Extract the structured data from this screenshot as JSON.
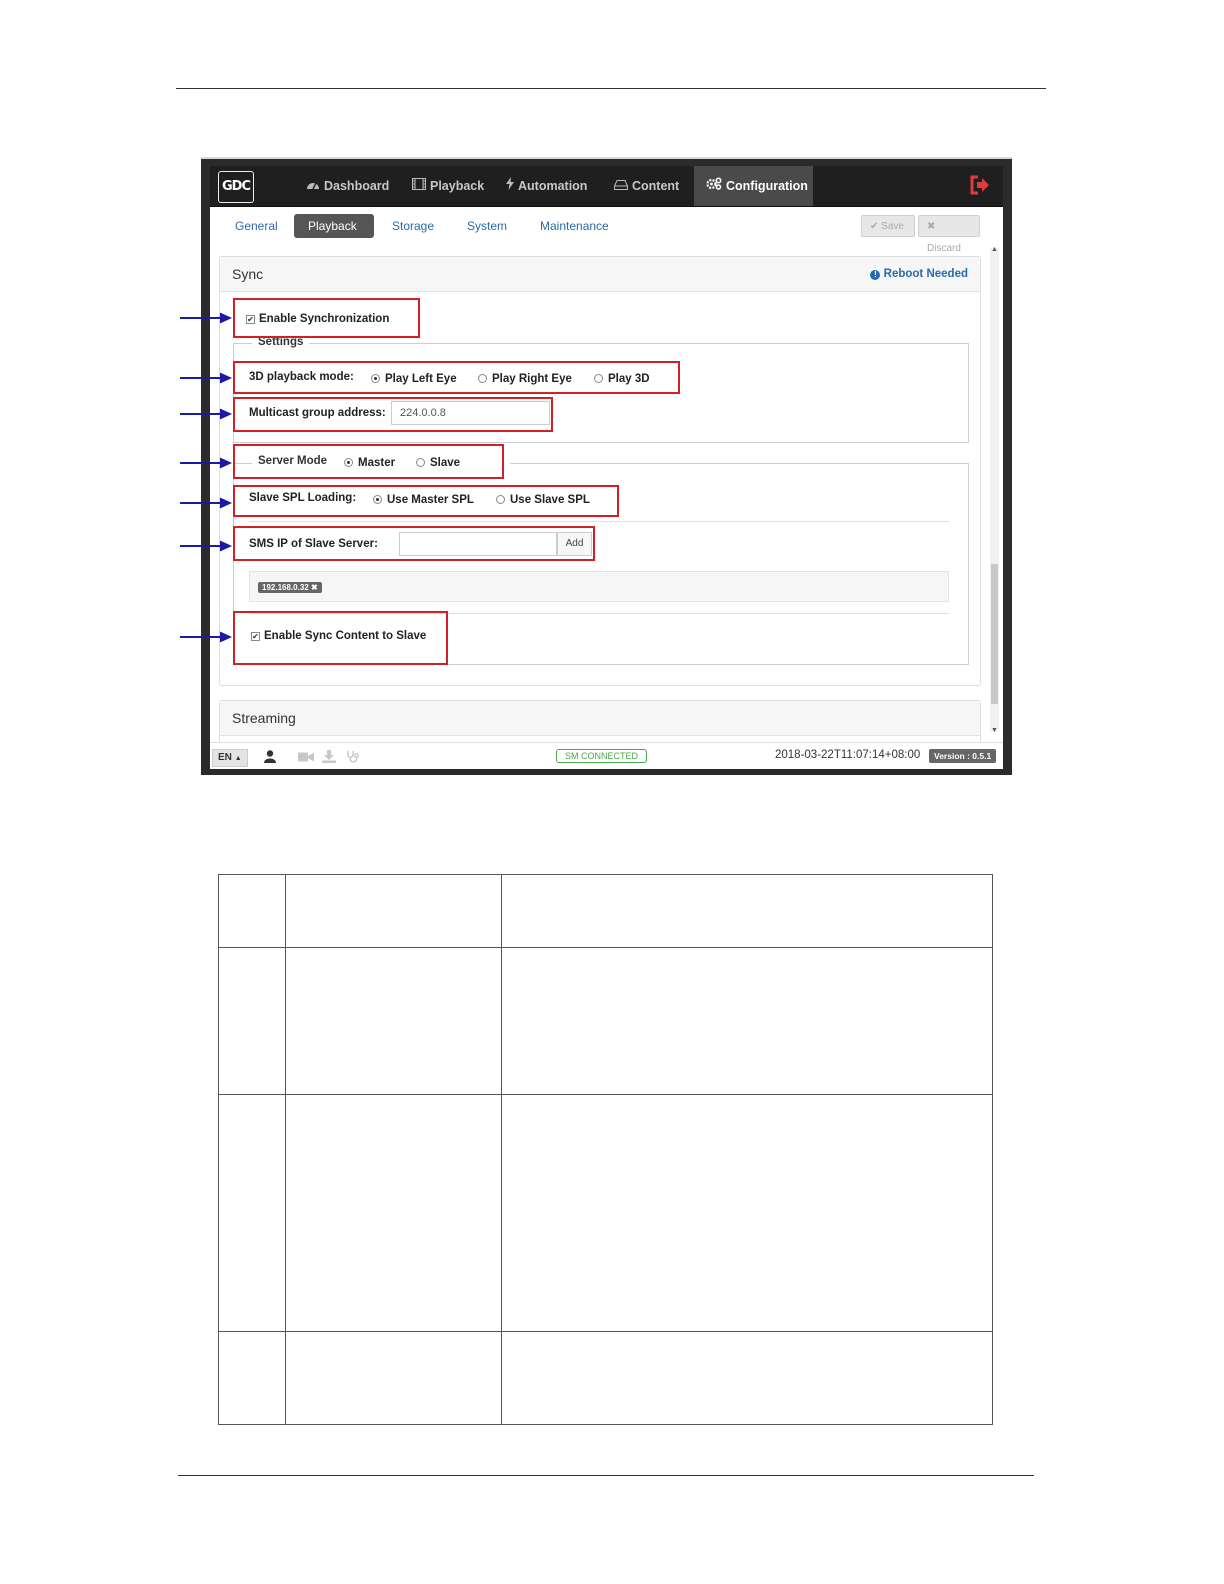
{
  "app": {
    "logo": "GDC",
    "nav": [
      {
        "label": "Dashboard",
        "icon": "dashboard-icon"
      },
      {
        "label": "Playback",
        "icon": "film-icon"
      },
      {
        "label": "Automation",
        "icon": "bolt-icon"
      },
      {
        "label": "Content",
        "icon": "drive-icon"
      },
      {
        "label": "Configuration",
        "icon": "gears-icon",
        "active": true
      }
    ],
    "subtabs": [
      "General",
      "Playback",
      "Storage",
      "System",
      "Maintenance"
    ],
    "active_subtab": "Playback",
    "save_label": "Save",
    "discard_label": "Discard"
  },
  "sync": {
    "title": "Sync",
    "reboot_notice": "Reboot Needed",
    "enable_sync_label": "Enable Synchronization",
    "enable_sync_checked": true,
    "settings_legend": "Settings",
    "playback_mode_label": "3D playback mode:",
    "playback_mode_options": [
      "Play Left Eye",
      "Play Right Eye",
      "Play 3D"
    ],
    "playback_mode_selected": "Play Left Eye",
    "multicast_label": "Multicast group address:",
    "multicast_value": "224.0.0.8",
    "server_mode_label": "Server Mode",
    "server_mode_options": [
      "Master",
      "Slave"
    ],
    "server_mode_selected": "Master",
    "slave_spl_label": "Slave SPL Loading:",
    "slave_spl_options": [
      "Use Master SPL",
      "Use Slave SPL"
    ],
    "slave_spl_selected": "Use Master SPL",
    "sms_ip_label": "SMS IP of Slave Server:",
    "sms_ip_value": "",
    "add_label": "Add",
    "slave_ip_tag": "192.168.0.32",
    "enable_sync_content_label": "Enable Sync Content to Slave",
    "enable_sync_content_checked": true
  },
  "streaming": {
    "title": "Streaming"
  },
  "status": {
    "language": "EN",
    "connection": "SM CONNECTED",
    "timestamp": "2018-03-22T11:07:14+08:00",
    "version": "Version : 0.5.1"
  },
  "colors": {
    "callout_box": "#d0202a",
    "arrow": "#1a1aa6",
    "link": "#2a6aa8"
  }
}
